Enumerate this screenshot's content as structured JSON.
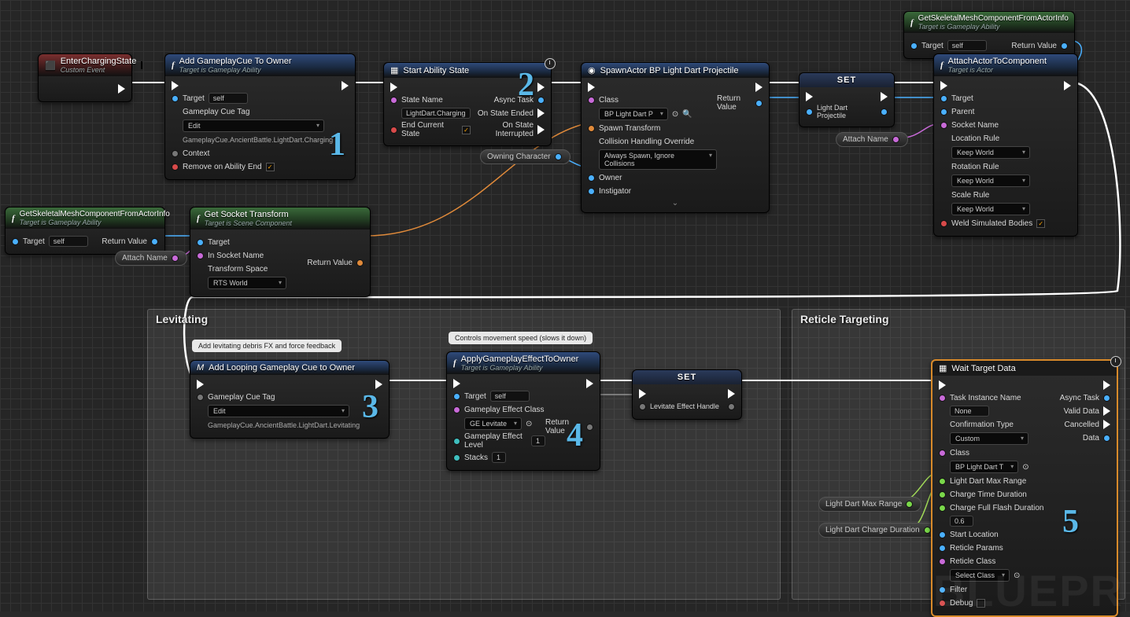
{
  "annotations": {
    "n1": "1",
    "n2": "2",
    "n3": "3",
    "n4": "4",
    "n5": "5"
  },
  "watermark": "BLUEPR",
  "comments": {
    "levitating": "Levitating",
    "reticle": "Reticle Targeting",
    "bubble_levitate": "Add levitating debris FX and force feedback",
    "bubble_movement": "Controls movement speed (slows it down)"
  },
  "pills": {
    "owning_character": "Owning Character",
    "attach_name_1": "Attach Name",
    "attach_name_2": "Attach Name",
    "max_range": "Light Dart Max Range",
    "charge_dur": "Light Dart Charge Duration"
  },
  "nodes": {
    "enter": {
      "title": "EnterChargingState",
      "sub": "Custom Event"
    },
    "addcue": {
      "title": "Add GameplayCue To Owner",
      "sub": "Target is Gameplay Ability",
      "target": "Target",
      "self": "self",
      "tag_label": "Gameplay Cue Tag",
      "edit": "Edit",
      "tag_text": "GameplayCue.AncientBattle.LightDart.Charging",
      "context": "Context",
      "remove": "Remove on Ability End"
    },
    "startstate": {
      "title": "Start Ability State",
      "state_label": "State Name",
      "state_val": "LightDart.Charging",
      "end_current": "End Current State",
      "async": "Async Task",
      "on_ended": "On State Ended",
      "on_int": "On State Interrupted"
    },
    "spawn": {
      "title": "SpawnActor BP Light Dart Projectile",
      "class_l": "Class",
      "class_v": "BP Light Dart P",
      "ret": "Return Value",
      "st": "Spawn Transform",
      "col_l": "Collision Handling Override",
      "col_v": "Always Spawn, Ignore Collisions",
      "owner": "Owner",
      "inst": "Instigator"
    },
    "set1": {
      "title": "SET",
      "pin": "Light Dart Projectile"
    },
    "getmesh1": {
      "title": "GetSkeletalMeshComponentFromActorInfo",
      "sub": "Target is Gameplay Ability",
      "target": "Target",
      "self": "self",
      "ret": "Return Value"
    },
    "attach": {
      "title": "AttachActorToComponent",
      "sub": "Target is Actor",
      "target": "Target",
      "parent": "Parent",
      "socket": "Socket Name",
      "loc_l": "Location Rule",
      "rot_l": "Rotation Rule",
      "scale_l": "Scale Rule",
      "kw": "Keep World",
      "weld": "Weld Simulated Bodies"
    },
    "getmesh2": {
      "title": "GetSkeletalMeshComponentFromActorInfo",
      "sub": "Target is Gameplay Ability",
      "target": "Target",
      "self": "self",
      "ret": "Return Value"
    },
    "socket": {
      "title": "Get Socket Transform",
      "sub": "Target is Scene Component",
      "target": "Target",
      "in_socket": "In Socket Name",
      "space_l": "Transform Space",
      "space_v": "RTS World",
      "ret": "Return Value"
    },
    "loopcue": {
      "title": "Add Looping Gameplay Cue to Owner",
      "tag_l": "Gameplay Cue Tag",
      "edit": "Edit",
      "tag_text": "GameplayCue.AncientBattle.LightDart.Levitating"
    },
    "applyge": {
      "title": "ApplyGameplayEffectToOwner",
      "sub": "Target is Gameplay Ability",
      "target": "Target",
      "self": "self",
      "gec_l": "Gameplay Effect Class",
      "gec_v": "GE Levitate",
      "lvl": "Gameplay Effect Level",
      "lvl_v": "1",
      "stacks": "Stacks",
      "stacks_v": "1",
      "ret": "Return Value"
    },
    "set2": {
      "title": "SET",
      "pin": "Levitate Effect Handle"
    },
    "wait": {
      "title": "Wait Target Data",
      "tin_l": "Task Instance Name",
      "tin_v": "None",
      "conf_l": "Confirmation Type",
      "conf_v": "Custom",
      "class_l": "Class",
      "class_v": "BP Light Dart T",
      "async": "Async Task",
      "valid": "Valid Data",
      "cancel": "Cancelled",
      "data": "Data",
      "max_range": "Light Dart Max Range",
      "charge_time": "Charge Time Duration",
      "flash_l": "Charge Full Flash Duration",
      "flash_v": "0.6",
      "start_loc": "Start Location",
      "rparams": "Reticle Params",
      "rclass_l": "Reticle Class",
      "rclass_v": "Select Class",
      "filter": "Filter",
      "debug": "Debug"
    }
  }
}
